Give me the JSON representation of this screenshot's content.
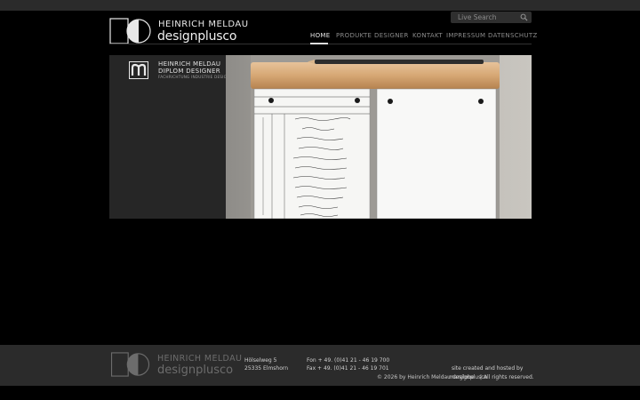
{
  "header": {
    "logo_line1": "HEINRICH MELDAU",
    "logo_line2": "designplusco",
    "search_placeholder": "Live Search"
  },
  "nav": {
    "items": [
      {
        "label": "HOME",
        "active": true
      },
      {
        "label": "PRODUKTE",
        "active": false
      },
      {
        "label": "DESIGNER",
        "active": false
      },
      {
        "label": "KONTAKT",
        "active": false
      },
      {
        "label": "IMPRESSUM",
        "active": false
      },
      {
        "label": "DATENSCHUTZ",
        "active": false
      }
    ]
  },
  "banner": {
    "line1": "HEINRICH MELDAU",
    "line2": "DIPLOM DESIGNER",
    "line3": "FACHRICHTUNG   INDUSTRIE DESIGN"
  },
  "footer": {
    "logo_line1": "HEINRICH MELDAU",
    "logo_line2": "designplusco",
    "street": "Hölselweg 5",
    "city": "25335 Elmshorn",
    "phone": "Fon + 49. (0)41 21 - 46 19 700",
    "fax": "Fax + 49. (0)41 21 - 46 19 701",
    "credit": "site created and hosted by",
    "copyright": "© 2026 by Heinrich Meldau designplusco",
    "credit_link": "marglobe",
    "rights": "|  All rights reserved."
  },
  "colors": {
    "background": "#000000",
    "bar": "#2b2b2b",
    "nav_active": "#e6e6e6",
    "nav_inactive": "#8a8a8a"
  }
}
